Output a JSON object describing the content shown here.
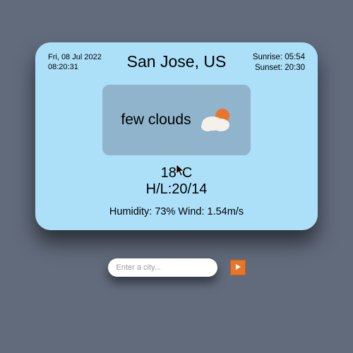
{
  "header": {
    "date": "Fri, 08 Jul 2022",
    "time": "08:20:31",
    "location": "San Jose, US",
    "sunrise": "Sunrise: 05:54",
    "sunset": "Sunset: 20:30"
  },
  "condition": {
    "text": "few clouds",
    "icon": "few-clouds-icon"
  },
  "readings": {
    "temp": "18°C",
    "high_low": "H/L:20/14",
    "details": "Humidity: 73% Wind: 1.54m/s"
  },
  "search": {
    "placeholder": "Enter a city...",
    "value": ""
  }
}
